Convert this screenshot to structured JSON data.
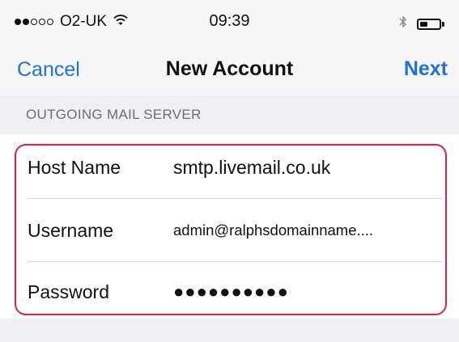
{
  "status_bar": {
    "signal_bars_filled": 2,
    "signal_bars_total": 5,
    "carrier": "O2-UK",
    "time": "09:39",
    "battery_level": 0.4,
    "icons": [
      "signal-icon",
      "wifi-icon",
      "bluetooth-icon",
      "battery-icon"
    ]
  },
  "nav": {
    "cancel_label": "Cancel",
    "title": "New Account",
    "next_label": "Next"
  },
  "section": {
    "header": "OUTGOING MAIL SERVER"
  },
  "fields": {
    "host_name_label": "Host Name",
    "host_name_value": "smtp.livemail.co.uk",
    "username_label": "Username",
    "username_value": "admin@ralphsdomainname....",
    "password_label": "Password",
    "password_value": "●●●●●●●●●●"
  },
  "colors": {
    "accent": "#1a73e0",
    "highlight": "#e0203a",
    "background": "#f7f7f7",
    "section_background": "#efeff4"
  }
}
